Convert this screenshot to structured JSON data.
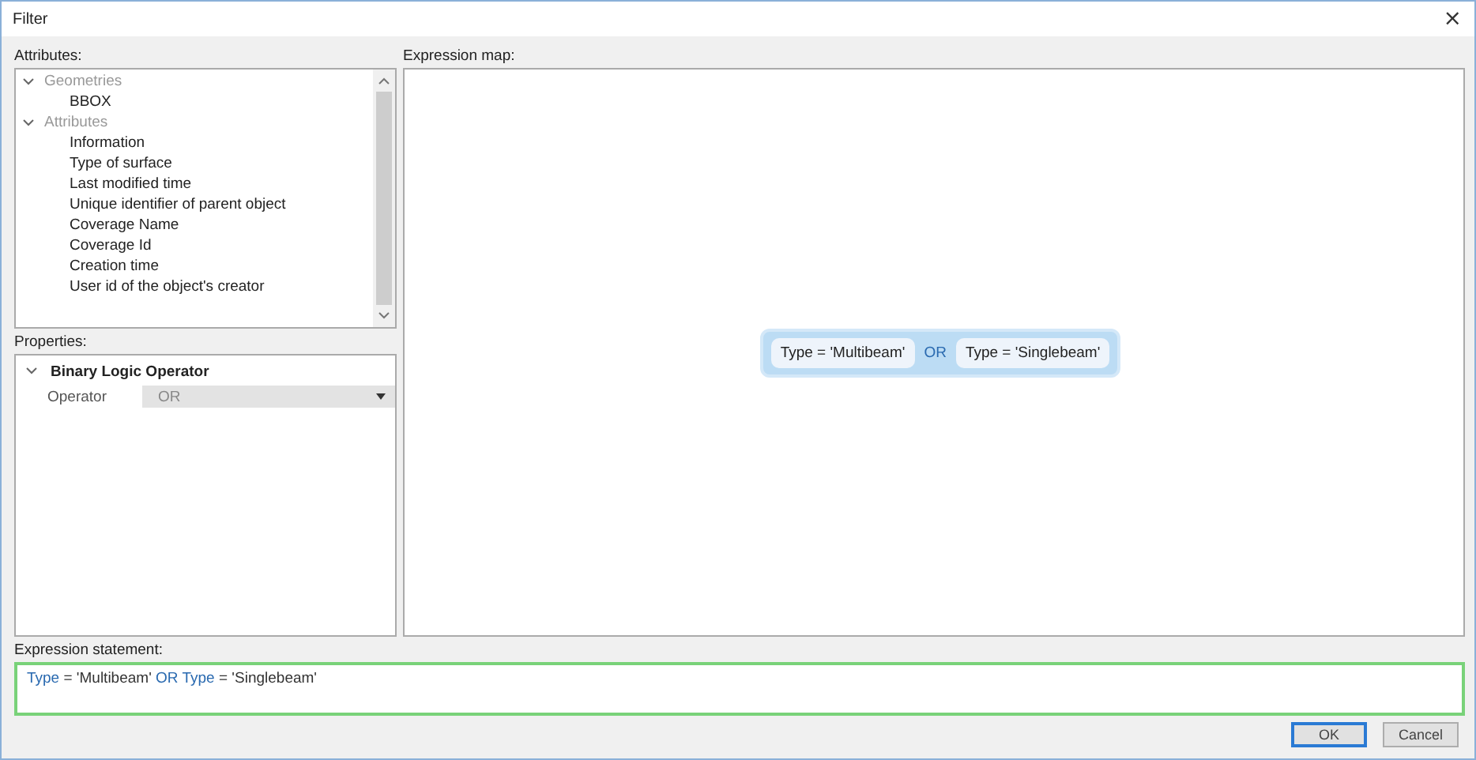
{
  "window": {
    "title": "Filter",
    "close": "×"
  },
  "attributes": {
    "label": "Attributes:",
    "tree": [
      {
        "label": "Geometries",
        "expanded": true,
        "disabled": true,
        "children": [
          {
            "label": "BBOX",
            "disabled": false
          }
        ]
      },
      {
        "label": "Attributes",
        "expanded": true,
        "disabled": true,
        "children": [
          {
            "label": "Information",
            "disabled": false
          },
          {
            "label": "Type of surface",
            "disabled": false
          },
          {
            "label": "Last modified time",
            "disabled": false
          },
          {
            "label": "Unique identifier of parent object",
            "disabled": false
          },
          {
            "label": "Coverage Name",
            "disabled": false
          },
          {
            "label": "Coverage Id",
            "disabled": false
          },
          {
            "label": "Creation time",
            "disabled": false
          },
          {
            "label": "User id of the object's creator",
            "disabled": false
          }
        ]
      }
    ]
  },
  "properties": {
    "label": "Properties:",
    "groups": [
      {
        "label": "Binary Logic Operator",
        "expanded": true,
        "rows": [
          {
            "name": "Operator",
            "value": "OR",
            "disabled": true
          }
        ]
      }
    ]
  },
  "map": {
    "label": "Expression map:",
    "nodes": [
      {
        "kind": "condition",
        "text": "Type = 'Multibeam'"
      },
      {
        "kind": "operator",
        "text": "OR"
      },
      {
        "kind": "condition",
        "text": "Type = 'Singlebeam'"
      }
    ]
  },
  "statement": {
    "label": "Expression statement:",
    "tokens": [
      {
        "kind": "field",
        "text": "Type"
      },
      {
        "kind": "plain",
        "text": "= 'Multibeam'"
      },
      {
        "kind": "operator",
        "text": "OR"
      },
      {
        "kind": "field",
        "text": "Type"
      },
      {
        "kind": "plain",
        "text": "= 'Singlebeam'"
      }
    ]
  },
  "buttons": [
    {
      "label": "OK",
      "default": true
    },
    {
      "label": "Cancel",
      "default": false
    }
  ]
}
